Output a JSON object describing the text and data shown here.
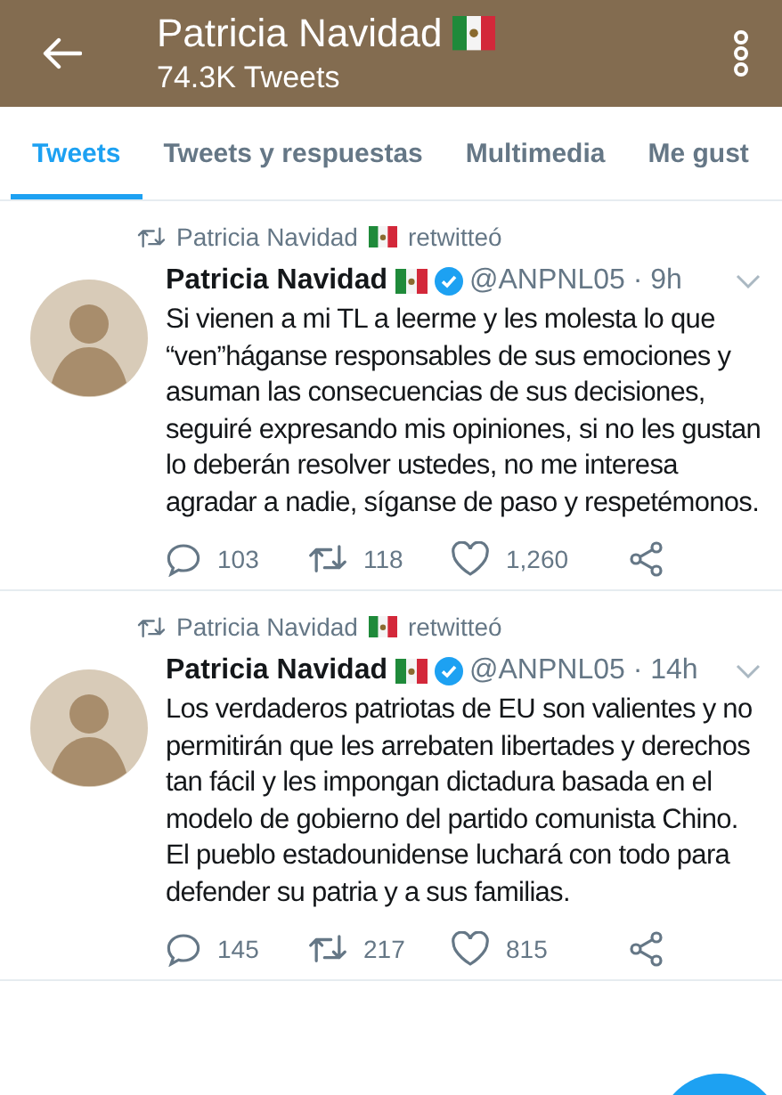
{
  "header": {
    "title": "Patricia Navidad",
    "subtitle": "74.3K Tweets"
  },
  "tabs": [
    {
      "label": "Tweets",
      "selected": true
    },
    {
      "label": "Tweets y respuestas",
      "selected": false
    },
    {
      "label": "Multimedia",
      "selected": false
    },
    {
      "label": "Me gust",
      "selected": false
    }
  ],
  "tweets": [
    {
      "retweeted_by": "Patricia Navidad",
      "retweet_label": "retwitteó",
      "author": "Patricia Navidad",
      "verified": true,
      "handle": "@ANPNL05 · 9h",
      "text": "Si vienen a mi TL a leerme y les molesta lo que “ven”háganse responsables de sus emociones y asuman las consecuencias de sus decisiones, seguiré expresando mis opiniones, si no les gustan lo deberán resolver ustedes, no me interesa agradar a nadie, síganse de paso y respetémonos.",
      "replies": "103",
      "retweets": "118",
      "likes": "1,260"
    },
    {
      "retweeted_by": "Patricia Navidad",
      "retweet_label": "retwitteó",
      "author": "Patricia Navidad",
      "verified": true,
      "handle": "@ANPNL05 · 14h",
      "text": "Los verdaderos patriotas de EU son valientes y no permitirán que les arrebaten libertades y derechos tan fácil y les impongan dictadura basada en el modelo de gobierno del partido comunista Chino. El pueblo estadounidense luchará con todo para defender su patria y a sus familias.",
      "replies": "145",
      "retweets": "217",
      "likes": "815"
    }
  ]
}
